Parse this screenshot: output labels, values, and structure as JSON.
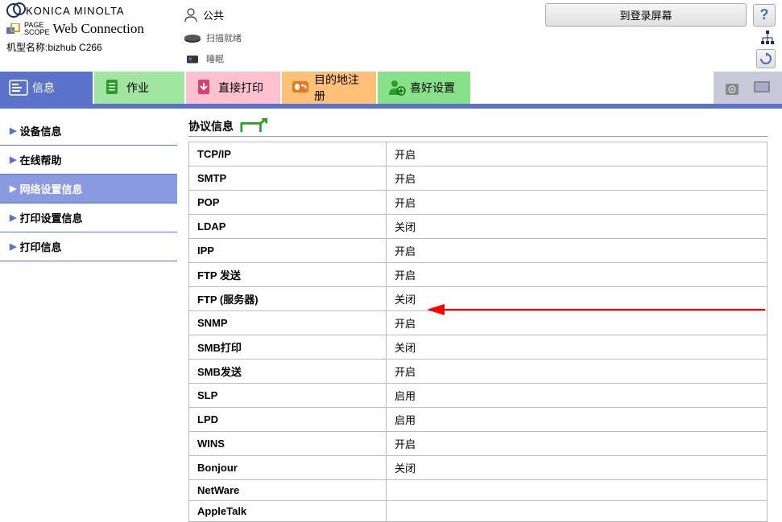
{
  "brand": "KONICA MINOLTA",
  "subbrand_small1": "PAGE",
  "subbrand_small2": "SCOPE",
  "subbrand_main": "Web Connection",
  "model_label": "机型名称:bizhub C266",
  "user_label": "公共",
  "login_btn": "到登录屏幕",
  "help_btn": "?",
  "status1": "扫描就绪",
  "status2": "睡眠",
  "tabs": {
    "info": "信息",
    "job": "作业",
    "print": "直接打印",
    "dest": "目的地注册",
    "pref": "喜好设置"
  },
  "sidebar": [
    "设备信息",
    "在线帮助",
    "网络设置信息",
    "打印设置信息",
    "打印信息"
  ],
  "main_title": "协议信息",
  "protocols": [
    {
      "name": "TCP/IP",
      "status": "开启"
    },
    {
      "name": "SMTP",
      "status": "开启"
    },
    {
      "name": "POP",
      "status": "开启"
    },
    {
      "name": "LDAP",
      "status": "关闭"
    },
    {
      "name": "IPP",
      "status": "开启"
    },
    {
      "name": "FTP 发送",
      "status": "开启"
    },
    {
      "name": "FTP (服务器)",
      "status": "关闭"
    },
    {
      "name": "SNMP",
      "status": "开启"
    },
    {
      "name": "SMB打印",
      "status": "关闭"
    },
    {
      "name": "SMB发送",
      "status": "开启"
    },
    {
      "name": "SLP",
      "status": "启用"
    },
    {
      "name": "LPD",
      "status": "启用"
    },
    {
      "name": "WINS",
      "status": "开启"
    },
    {
      "name": "Bonjour",
      "status": "关闭"
    },
    {
      "name": "NetWare",
      "status": ""
    },
    {
      "name": "AppleTalk",
      "status": ""
    }
  ]
}
